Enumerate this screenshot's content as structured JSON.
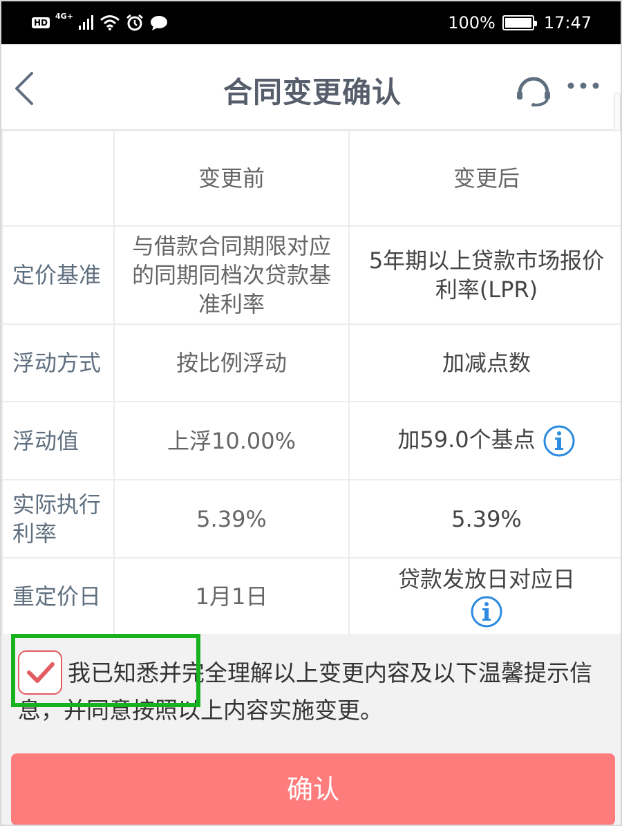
{
  "status_bar": {
    "hd": "HD",
    "network": "4G+",
    "battery": "100%",
    "time": "17:47",
    "icons": [
      "signal-icon",
      "wifi-icon",
      "alarm-icon",
      "message-icon",
      "battery-icon"
    ]
  },
  "nav": {
    "title": "合同变更确认",
    "back_icon": "chevron-left-icon",
    "service_icon": "headset-icon",
    "more_icon": "more-icon"
  },
  "table": {
    "headers": [
      "",
      "变更前",
      "变更后"
    ],
    "rows": [
      {
        "label": "定价基准",
        "before": "与借款合同期限对应的同期同档次贷款基准利率",
        "after": "5年期以上贷款市场报价利率(LPR)"
      },
      {
        "label": "浮动方式",
        "before": "按比例浮动",
        "after": "加减点数"
      },
      {
        "label": "浮动值",
        "before": "上浮10.00%",
        "after": "加59.0个基点"
      },
      {
        "label": "实际执行利率",
        "before": "5.39%",
        "after": "5.39%"
      },
      {
        "label": "重定价日",
        "before": "1月1日",
        "after": "贷款发放日对应日"
      }
    ]
  },
  "agreement": {
    "checked": true,
    "text": "我已知悉并完全理解以上变更内容及以下温馨提示信息，并同意按照以上内容实施变更。"
  },
  "confirm_button": "确认",
  "colors": {
    "accent": "#ff7c7d",
    "checkbox": "#e25c62",
    "highlight": "#17b21d",
    "info": "#2d8be0",
    "title": "#555e6a"
  }
}
